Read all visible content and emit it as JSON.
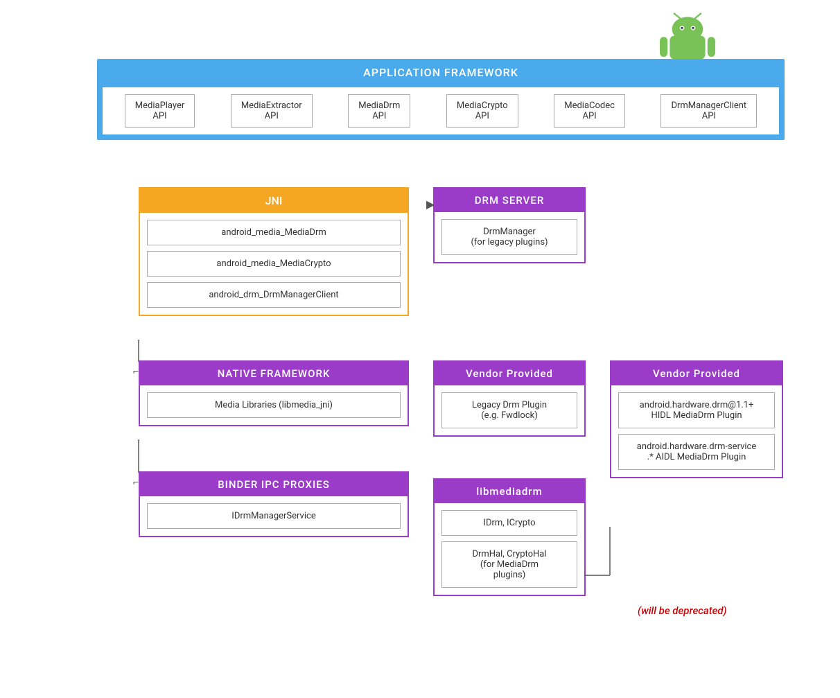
{
  "android_logo": {
    "alt": "Android Logo"
  },
  "app_framework": {
    "title": "APPLICATION FRAMEWORK",
    "apis": [
      {
        "name": "MediaPlayer\nAPI"
      },
      {
        "name": "MediaExtractor\nAPI"
      },
      {
        "name": "MediaDrm\nAPI"
      },
      {
        "name": "MediaCrypto\nAPI"
      },
      {
        "name": "MediaCodec\nAPI"
      },
      {
        "name": "DrmManagerClient\nAPI"
      }
    ]
  },
  "jni": {
    "title": "JNI",
    "items": [
      "android_media_MediaDrm",
      "android_media_MediaCrypto",
      "android_drm_DrmManagerClient"
    ]
  },
  "native_framework": {
    "title": "NATIVE FRAMEWORK",
    "items": [
      "Media Libraries (libmedia_jni)"
    ]
  },
  "binder_ipc": {
    "title": "BINDER IPC PROXIES",
    "items": [
      "IDrmManagerService"
    ]
  },
  "drm_server": {
    "title": "DRM SERVER",
    "items": [
      "DrmManager\n(for legacy plugins)"
    ]
  },
  "vendor_left": {
    "title": "Vendor Provided",
    "items": [
      "Legacy Drm Plugin\n(e.g. Fwdlock)"
    ]
  },
  "vendor_right": {
    "title": "Vendor Provided",
    "items": [
      "android.hardware.drm@1.1+\nHIDL MediaDrm Plugin",
      "android.hardware.drm-service\n.* AIDL MediaDrm Plugin"
    ]
  },
  "libmediadrm": {
    "title": "libmediadrm",
    "items": [
      "IDrm, ICrypto",
      "DrmHal, CryptoHal\n(for MediaDrm\nplugins)"
    ]
  },
  "deprecated": {
    "text": "(will be deprecated)"
  }
}
